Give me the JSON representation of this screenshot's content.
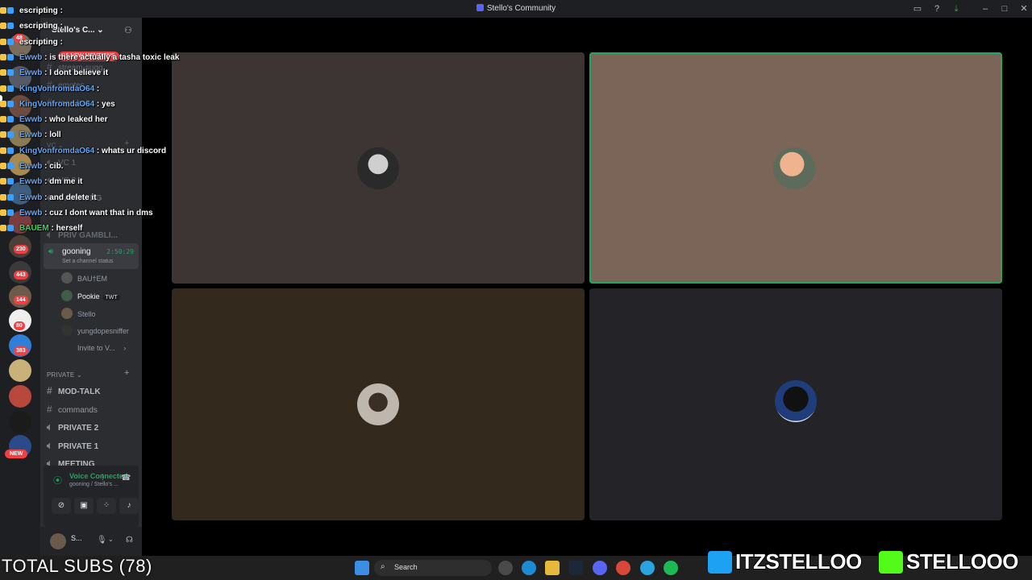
{
  "window": {
    "title": "Stello's Community",
    "controls": [
      "inbox-icon",
      "help-icon",
      "download-icon",
      "minimize",
      "maximize",
      "close"
    ]
  },
  "server": {
    "name": "Stello's C...",
    "new_mentions": "16 NEW MENTIONS"
  },
  "rail_badges": [
    "48",
    "230",
    "443",
    "144",
    "80",
    "383",
    "NEW"
  ],
  "channels": [
    {
      "name": "stream-sugg..."
    },
    {
      "name": "emotes"
    },
    {
      "name": "rage-bait"
    }
  ],
  "categories": {
    "vc": "VC",
    "private": "PRIVATE"
  },
  "voice_channels": [
    {
      "name": "VC 1"
    },
    {
      "name": "VC 2"
    },
    {
      "name": "GAMBLING"
    },
    {
      "name": "PRIV GAMBLI..."
    }
  ],
  "active_vc": {
    "name": "gooning",
    "timer": "2:50:29",
    "status": "Set a channel status"
  },
  "vc_members": [
    {
      "name": "BAU†EM",
      "tag": ""
    },
    {
      "name": "Pookie",
      "tag": "TWT"
    },
    {
      "name": "Stello",
      "tag": ""
    },
    {
      "name": "yungdopesniffer",
      "tag": ""
    },
    {
      "name": "Invite to V...",
      "tag": ""
    }
  ],
  "private_channels": [
    {
      "name": "MOD-TALK"
    },
    {
      "name": "commands"
    },
    {
      "name": "PRIVATE 2"
    },
    {
      "name": "PRIVATE 1"
    },
    {
      "name": "MEETING"
    }
  ],
  "voice_panel": {
    "status": "Voice Connected",
    "sub": "gooning / Stello's ..."
  },
  "user_panel": {
    "name": "S..."
  },
  "chat": [
    {
      "user": "escripting",
      "message": "",
      "color": "white"
    },
    {
      "user": "escripting",
      "message": "",
      "color": "white"
    },
    {
      "user": "escripting",
      "message": "",
      "color": "white"
    },
    {
      "user": "Ewwb",
      "message": "is there actually a tasha toxic leak",
      "color": "blue"
    },
    {
      "user": "Ewwb",
      "message": "I dont believe it",
      "color": "blue"
    },
    {
      "user": "KingVonfromdaO64",
      "message": "",
      "color": "blue"
    },
    {
      "user": "KingVonfromdaO64",
      "message": "yes",
      "color": "blue"
    },
    {
      "user": "Ewwb",
      "message": "who leaked her",
      "color": "blue"
    },
    {
      "user": "Ewwb",
      "message": "loll",
      "color": "blue"
    },
    {
      "user": "KingVonfromdaO64",
      "message": "whats ur discord",
      "color": "blue"
    },
    {
      "user": "Ewwb",
      "message": "cib.",
      "color": "blue"
    },
    {
      "user": "Ewwb",
      "message": "dm me it",
      "color": "blue"
    },
    {
      "user": "Ewwb",
      "message": "and delete it",
      "color": "blue"
    },
    {
      "user": "Ewwb",
      "message": "cuz I dont want that in dms",
      "color": "blue"
    },
    {
      "user": "BAUEM",
      "message": "herself",
      "color": "green"
    }
  ],
  "tiles": [
    {
      "bg": "#3d3534",
      "speaking": false
    },
    {
      "bg": "#7a6558",
      "speaking": true
    },
    {
      "bg": "#33291c",
      "speaking": false
    },
    {
      "bg": "#232328",
      "speaking": false
    }
  ],
  "taskbar": {
    "search_label": "Search"
  },
  "overlay": {
    "subs": "TOTAL SUBS (78)",
    "twitter": "ITZSTELLOO",
    "kick": "STELLOOO"
  },
  "colors": {
    "accent_green": "#23a55a",
    "mention_red": "#f23f43",
    "sidebar": "#2b2d31",
    "rail": "#1e1f22"
  }
}
